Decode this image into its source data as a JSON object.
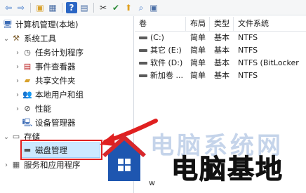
{
  "toolbar": {
    "buttons": [
      {
        "name": "back-icon",
        "glyph": "⇦"
      },
      {
        "name": "forward-icon",
        "glyph": "⇨"
      },
      {
        "name": "up-folder-icon",
        "glyph": "📂"
      },
      {
        "name": "console-tree-icon",
        "glyph": "▦"
      },
      {
        "name": "help-icon",
        "glyph": "?"
      },
      {
        "name": "properties-icon",
        "glyph": "▤"
      },
      {
        "name": "disconnect-icon",
        "glyph": "✂"
      },
      {
        "name": "check-icon",
        "glyph": "✔"
      },
      {
        "name": "up-arrow-icon",
        "glyph": "⬆"
      },
      {
        "name": "search-icon",
        "glyph": "🔍"
      },
      {
        "name": "view-icon",
        "glyph": "▣"
      }
    ]
  },
  "tree": {
    "root": "计算机管理(本地)",
    "system_tools": "系统工具",
    "task_scheduler": "任务计划程序",
    "event_viewer": "事件查看器",
    "shared_folders": "共享文件夹",
    "local_users": "本地用户和组",
    "performance": "性能",
    "device_manager": "设备管理器",
    "storage": "存储",
    "disk_management": "磁盘管理",
    "services_apps": "服务和应用程序"
  },
  "list": {
    "headers": {
      "volume": "卷",
      "layout": "布局",
      "type": "类型",
      "fs": "文件系统"
    },
    "rows": [
      {
        "volume": "(C:)",
        "layout": "简单",
        "type": "基本",
        "fs": "NTFS"
      },
      {
        "volume": "其它 (E:)",
        "layout": "简单",
        "type": "基本",
        "fs": "NTFS"
      },
      {
        "volume": "软件 (D:)",
        "layout": "简单",
        "type": "基本",
        "fs": "NTFS (BitLocker"
      },
      {
        "volume": "新加卷 ...",
        "layout": "简单",
        "type": "基本",
        "fs": "NTFS"
      }
    ]
  },
  "watermark": {
    "text": "电脑基地",
    "ghost_text": "电脑系统网",
    "url": "w",
    "colors": {
      "blue": "#1e56b0",
      "red": "#d9272a",
      "dark": "#111111"
    }
  },
  "accent": {
    "selection": "#cce8ff",
    "callout": "#e02020"
  }
}
